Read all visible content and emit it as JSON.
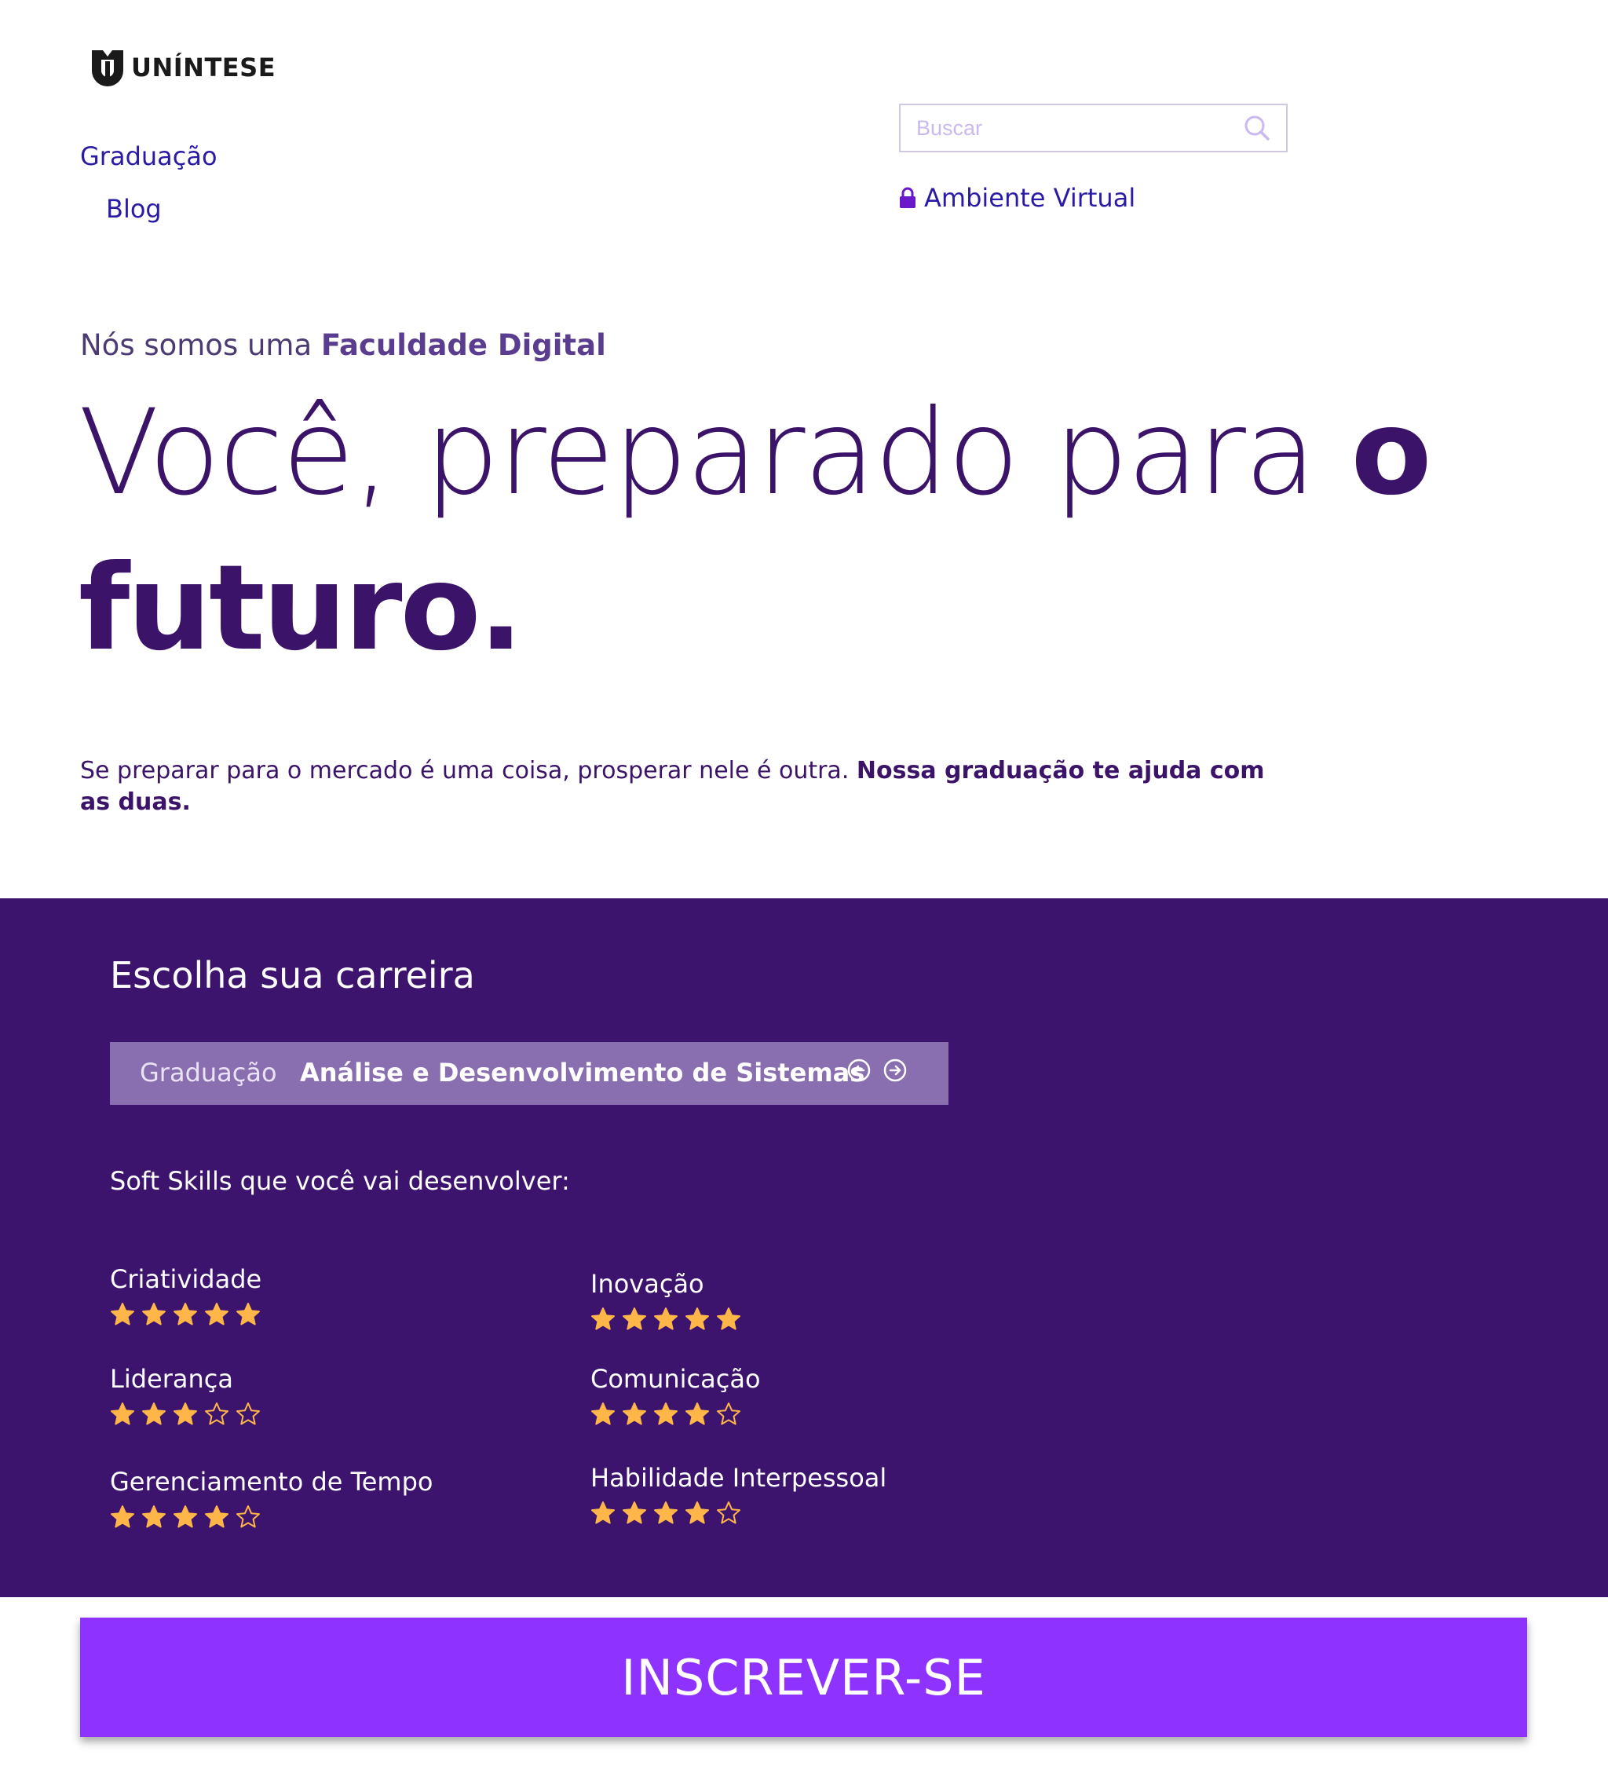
{
  "header": {
    "logo_text": "UNÍNTESE",
    "nav": [
      {
        "label": "Graduação"
      },
      {
        "label": "Blog"
      }
    ],
    "search": {
      "placeholder": "Buscar",
      "icon": "search-icon"
    },
    "ambiente_virtual": {
      "label": "Ambiente Virtual",
      "icon": "lock-icon"
    }
  },
  "hero": {
    "subtitle_prefix": "Nós somos uma ",
    "subtitle_bold": "Faculdade Digital",
    "headline_part1": "Você, preparado para ",
    "headline_part1_bold": "o",
    "headline_part2": "futuro.",
    "description": "Se preparar para o mercado é uma coisa, prosperar nele é outra. ",
    "description_bold": "Nossa graduação te ajuda com as duas."
  },
  "career": {
    "title": "Escolha sua carreira",
    "kind": "Graduação",
    "course": "Análise e Desenvolvimento de Sistemas",
    "softskills_title": "Soft Skills que você vai desenvolver:",
    "skills": [
      {
        "name": "Criatividade",
        "rating": 5
      },
      {
        "name": "Inovação",
        "rating": 5
      },
      {
        "name": "Liderança",
        "rating": 3
      },
      {
        "name": "Comunicação",
        "rating": 4
      },
      {
        "name": "Gerenciamento de Tempo",
        "rating": 4
      },
      {
        "name": "Habilidade Interpessoal",
        "rating": 4
      }
    ],
    "max_rating": 5
  },
  "cta": {
    "label": "INSCREVER-SE"
  },
  "colors": {
    "brand_purple": "#3c136d",
    "link_blue": "#2a1ba6",
    "cta_purple": "#8e33ff",
    "career_bar": "#8a6fb0",
    "star_fill": "#ffb649"
  }
}
